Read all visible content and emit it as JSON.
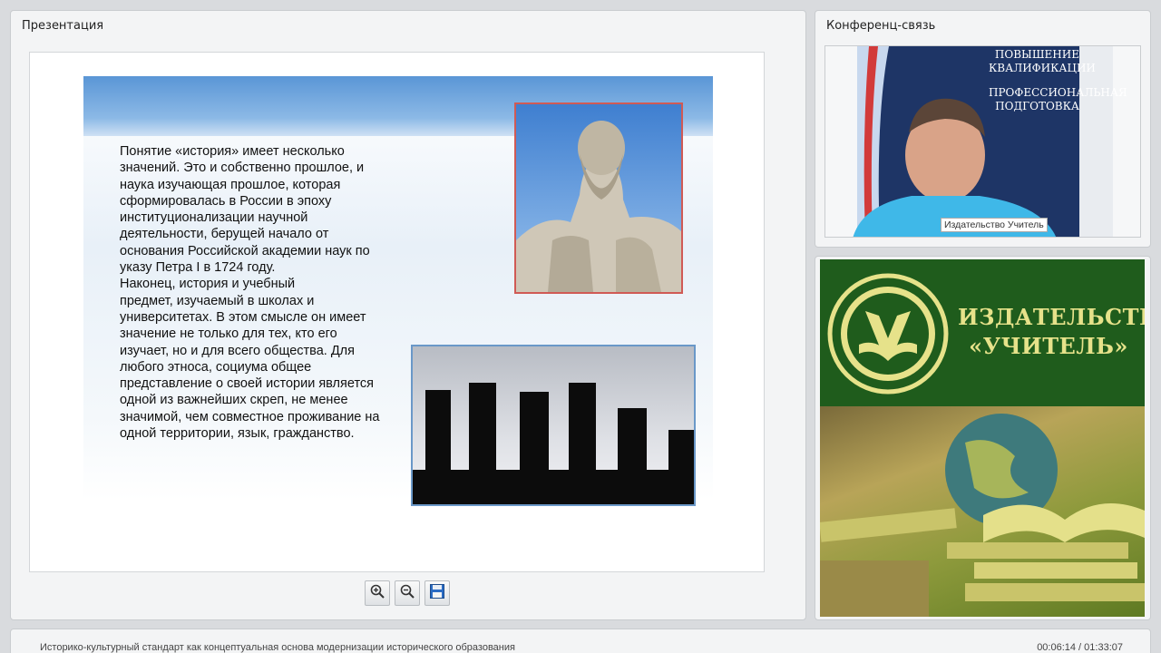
{
  "presentation": {
    "panel_title": "Презентация",
    "slide_text_1": "Понятие «история» имеет несколько\nзначений. Это и собственно прошлое, и\nнаука изучающая прошлое, которая\nсформировалась в России в эпоху\nинституционализации научной\nдеятельности, берущей начало от\nоснования Российской академии наук по\nуказу Петра I в 1724 году.",
    "slide_text_2": "Наконец, история и учебный\nпредмет, изучаемый в школах и\nуниверситетах. В этом смысле он имеет\nзначение не только для тех, кто его\nизучает, но и для всего общества. Для\nлюбого этноса, социума общее\nпредставление о своей истории является\nодной из важнейших скреп, не менее\nзначимой, чем совместное проживание на\nодной территории, язык, гражданство.",
    "tools": [
      {
        "icon": "zoom-in-icon"
      },
      {
        "icon": "zoom-out-icon"
      },
      {
        "icon": "save-icon"
      }
    ]
  },
  "conference": {
    "panel_title": "Конференц-связь",
    "speaker_label": "Издательство Учитель",
    "banner_lines": [
      "ПОВЫШЕНИЕ",
      "КВАЛИФИКАЦИИ",
      "ПРОФЕССИОНАЛЬНАЯ",
      "ПОДГОТОВКА"
    ]
  },
  "publisher": {
    "name_line1": "ИЗДАТЕЛЬСТВО",
    "name_line2": "«УЧИТЕЛЬ»",
    "brand_green": "#1f5c1c",
    "brand_yellow": "#e6e28a"
  },
  "footer": {
    "title": "Историко-культурный стандарт как концептуальная основа модернизации исторического образования",
    "time": "00:06:14 / 01:33:07"
  }
}
